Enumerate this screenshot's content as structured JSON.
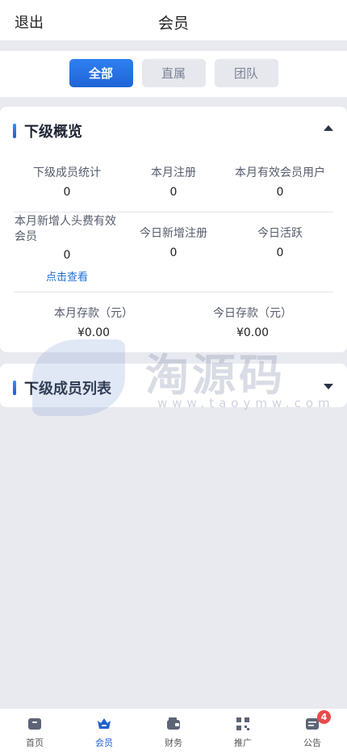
{
  "header": {
    "back_label": "退出",
    "title": "会员"
  },
  "filter_tabs": [
    {
      "label": "全部",
      "active": true
    },
    {
      "label": "直属",
      "active": false
    },
    {
      "label": "团队",
      "active": false
    }
  ],
  "overview": {
    "title": "下级概览",
    "row1": [
      {
        "label": "下级成员统计",
        "value": "0"
      },
      {
        "label": "本月注册",
        "value": "0"
      },
      {
        "label": "本月有效会员用户",
        "value": "0"
      }
    ],
    "row2": [
      {
        "label": "本月新增人头费有效会员",
        "value": "0",
        "link": "点击查看"
      },
      {
        "label": "今日新增注册",
        "value": "0"
      },
      {
        "label": "今日活跃",
        "value": "0"
      }
    ],
    "row3": [
      {
        "label": "本月存款（元）",
        "value": "¥0.00"
      },
      {
        "label": "今日存款（元）",
        "value": "¥0.00"
      }
    ]
  },
  "member_list": {
    "title": "下级成员列表"
  },
  "watermark": {
    "text": "淘源码",
    "sub": "www.taoymw.com"
  },
  "tabbar": [
    {
      "label": "首页",
      "icon": "home-icon",
      "active": false
    },
    {
      "label": "会员",
      "icon": "crown-icon",
      "active": true
    },
    {
      "label": "财务",
      "icon": "wallet-icon",
      "active": false
    },
    {
      "label": "推广",
      "icon": "qr-code-icon",
      "active": false
    },
    {
      "label": "公告",
      "icon": "announcement-icon",
      "active": false,
      "badge": "4"
    }
  ],
  "colors": {
    "accent": "#1f64d6",
    "badge": "#e84b4b",
    "background": "#e9eaf0"
  }
}
